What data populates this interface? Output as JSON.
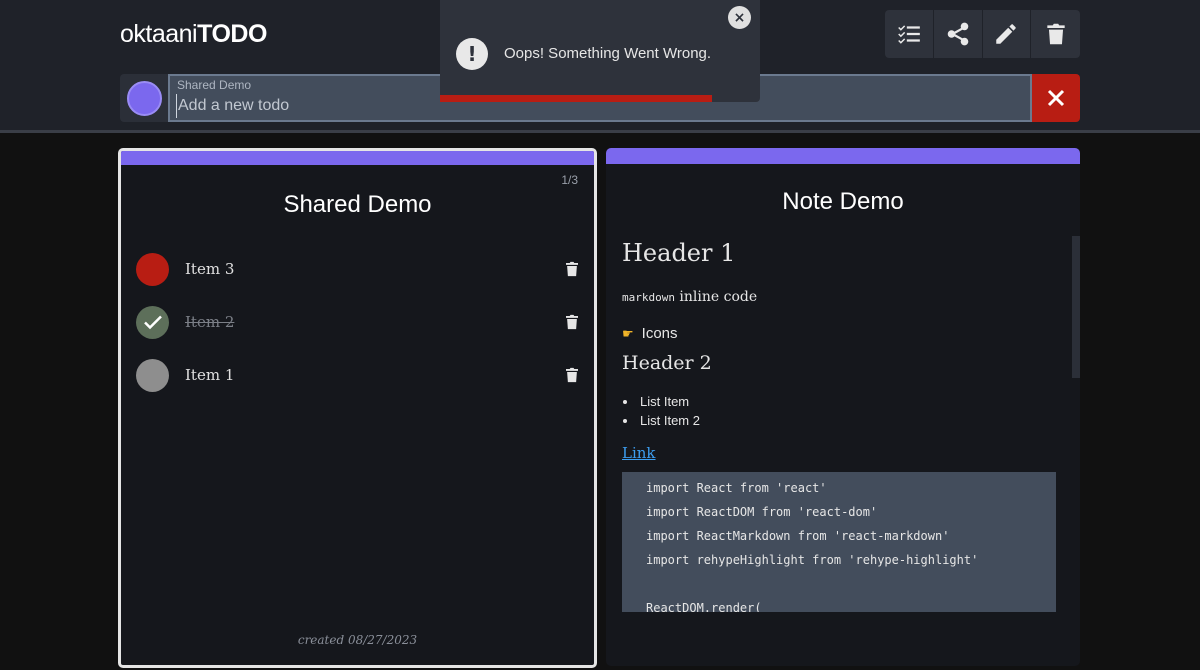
{
  "header": {
    "logo_light": "oktaani",
    "logo_bold": "TODO",
    "toolbar": [
      {
        "name": "checklist-icon"
      },
      {
        "name": "share-icon"
      },
      {
        "name": "pencil-icon"
      },
      {
        "name": "trash-icon"
      }
    ]
  },
  "input": {
    "list_label": "Shared Demo",
    "placeholder": "Add a new todo",
    "value": ""
  },
  "toast": {
    "message": "Oops! Something Went Wrong.",
    "icon": "exclamation-icon",
    "close_glyph": "×",
    "progress": 0.85
  },
  "left_card": {
    "counter": "1/3",
    "title": "Shared Demo",
    "items": [
      {
        "label": "Item 3",
        "done": false,
        "color": "#b81d13"
      },
      {
        "label": "Item 2",
        "done": true,
        "color": "#5d6f5a"
      },
      {
        "label": "Item 1",
        "done": false,
        "color": "#8e8e8e"
      }
    ],
    "created": "created 08/27/2023"
  },
  "right_card": {
    "title": "Note Demo",
    "h1": "Header 1",
    "inline_code": "markdown",
    "inline_code_suffix": " inline code",
    "icons_line": "Icons",
    "h2": "Header 2",
    "list": [
      "List Item",
      "List Item 2"
    ],
    "link": "Link",
    "code_lines": [
      "import React from 'react'",
      "import ReactDOM from 'react-dom'",
      "import ReactMarkdown from 'react-markdown'",
      "import rehypeHighlight from 'rehype-highlight'",
      "",
      "ReactDOM.render("
    ]
  },
  "colors": {
    "accent": "#7b68ee",
    "danger": "#b81d13",
    "header_bg": "#1f2229",
    "card_bg": "#15171c"
  }
}
